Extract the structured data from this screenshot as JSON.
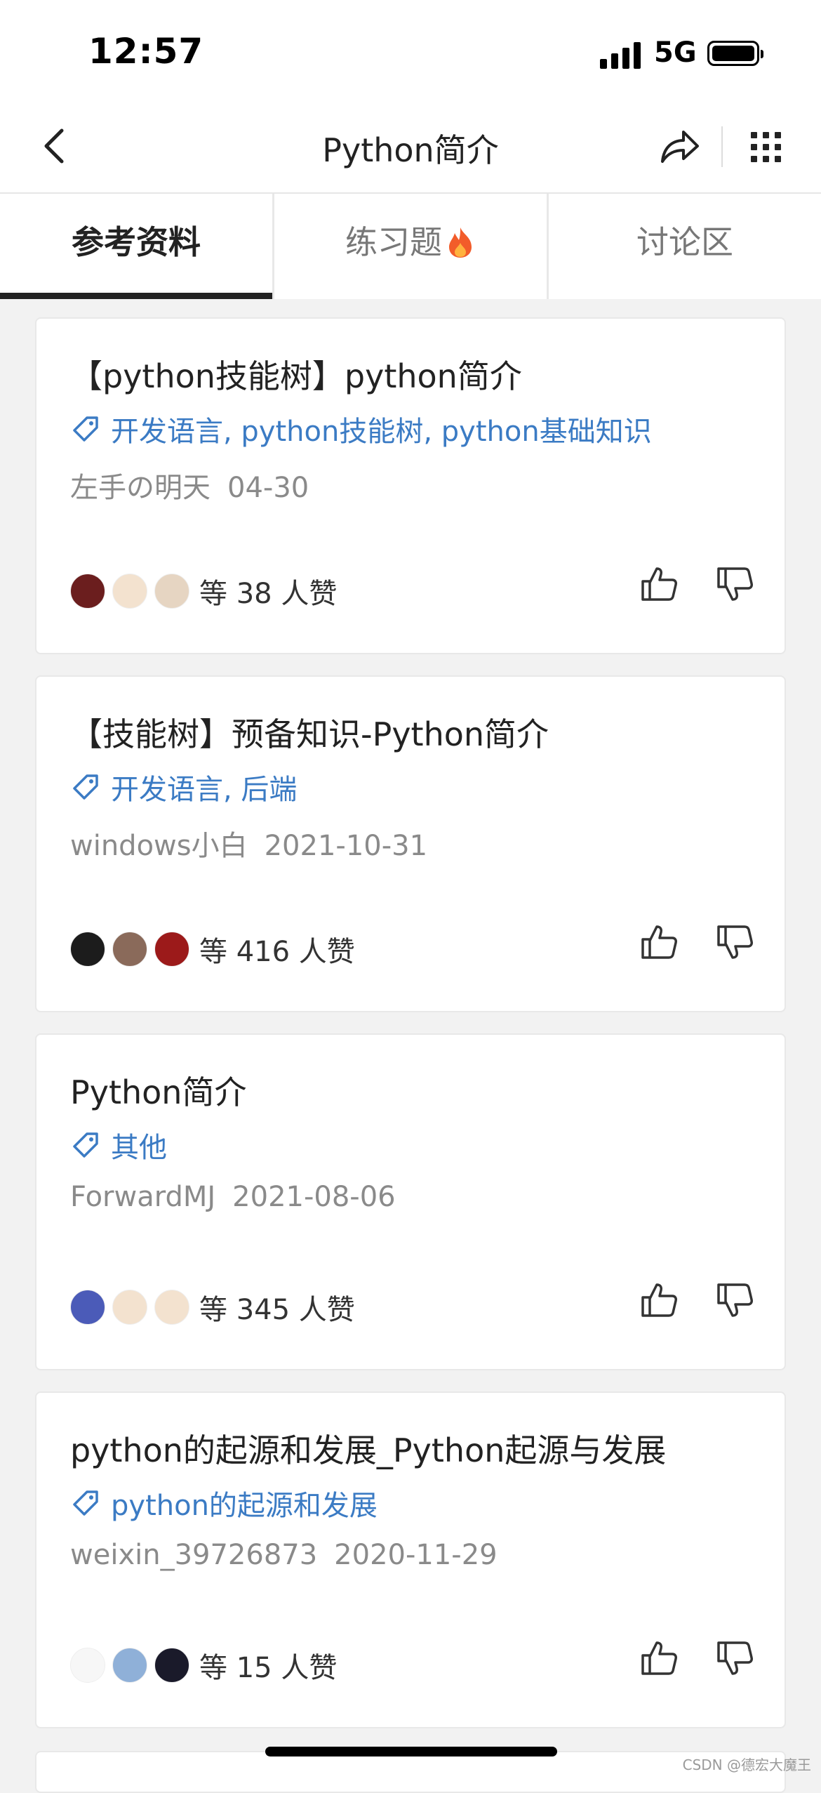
{
  "status_bar": {
    "time": "12:57",
    "network": "5G"
  },
  "nav": {
    "title": "Python简介"
  },
  "tabs": [
    {
      "label": "参考资料"
    },
    {
      "label": "练习题"
    },
    {
      "label": "讨论区"
    }
  ],
  "cards": [
    {
      "title": "【python技能树】python简介",
      "tags": "开发语言, python技能树, python基础知识",
      "author": "左手の明天",
      "date": "04-30",
      "likes": "等 38 人赞"
    },
    {
      "title": "【技能树】预备知识-Python简介",
      "tags": "开发语言, 后端",
      "author": "windows小白",
      "date": "2021-10-31",
      "likes": "等 416 人赞"
    },
    {
      "title": "Python简介",
      "tags": "其他",
      "author": "ForwardMJ",
      "date": "2021-08-06",
      "likes": "等 345 人赞"
    },
    {
      "title": "python的起源和发展_Python起源与发展",
      "tags": "python的起源和发展",
      "author": "weixin_39726873",
      "date": "2020-11-29",
      "likes": "等 15 人赞"
    }
  ],
  "watermark": "CSDN @德宏大魔王",
  "colors": {
    "tag_blue": "#3b7bc4",
    "tab_active": "#222222",
    "flame": "#f25c2a"
  }
}
